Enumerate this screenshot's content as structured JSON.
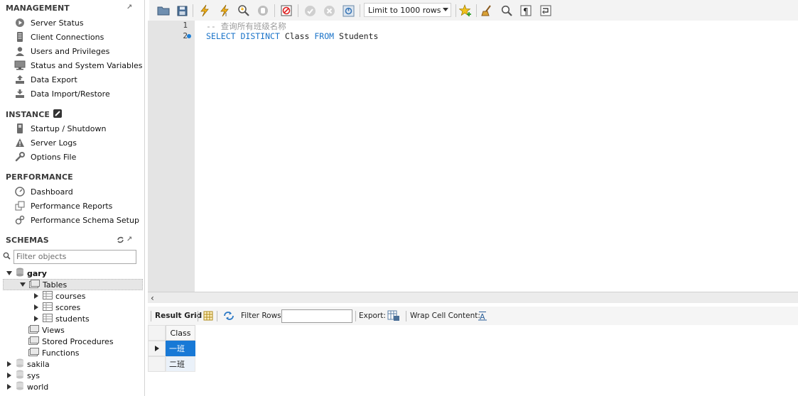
{
  "sidebar": {
    "management": {
      "title": "MANAGEMENT",
      "items": [
        {
          "label": "Server Status",
          "icon": "play-circle-icon"
        },
        {
          "label": "Client Connections",
          "icon": "server-icon"
        },
        {
          "label": "Users and Privileges",
          "icon": "user-icon"
        },
        {
          "label": "Status and System Variables",
          "icon": "monitor-icon"
        },
        {
          "label": "Data Export",
          "icon": "export-icon"
        },
        {
          "label": "Data Import/Restore",
          "icon": "import-icon"
        }
      ]
    },
    "instance": {
      "title": "INSTANCE",
      "items": [
        {
          "label": "Startup / Shutdown",
          "icon": "power-icon"
        },
        {
          "label": "Server Logs",
          "icon": "warning-icon"
        },
        {
          "label": "Options File",
          "icon": "wrench-icon"
        }
      ]
    },
    "performance": {
      "title": "PERFORMANCE",
      "items": [
        {
          "label": "Dashboard",
          "icon": "gauge-icon"
        },
        {
          "label": "Performance Reports",
          "icon": "reports-icon"
        },
        {
          "label": "Performance Schema Setup",
          "icon": "settings-icon"
        }
      ]
    },
    "schemas": {
      "title": "SCHEMAS",
      "filter_placeholder": "Filter objects",
      "tree": {
        "gary": "gary",
        "tables": "Tables",
        "courses": "courses",
        "scores": "scores",
        "students": "students",
        "views": "Views",
        "stored_procedures": "Stored Procedures",
        "functions": "Functions",
        "sakila": "sakila",
        "sys": "sys",
        "world": "world"
      }
    }
  },
  "toolbar": {
    "limit_value": "Limit to 1000 rows"
  },
  "editor": {
    "line_numbers": [
      "1",
      "2"
    ],
    "line1_comment": "-- 查询所有班级名称",
    "line2": {
      "select": "SELECT",
      "distinct": "DISTINCT",
      "col": "Class",
      "from": "FROM",
      "table": "Students"
    }
  },
  "result_toolbar": {
    "result_grid": "Result Grid",
    "filter_rows": "Filter Rows:",
    "export": "Export:",
    "wrap_cell": "Wrap Cell Content:"
  },
  "grid": {
    "column": "Class",
    "rows": [
      "一班",
      "二班"
    ]
  },
  "colors": {
    "keyword": "#1a73c8",
    "comment": "#9c9c9c",
    "selection": "#1879d6"
  }
}
